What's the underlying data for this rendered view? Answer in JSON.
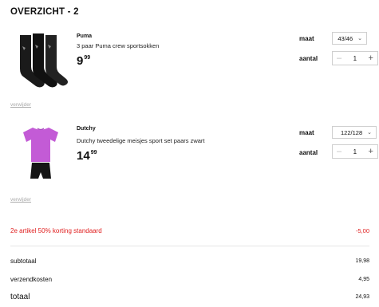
{
  "page": {
    "title": "OVERZICHT - 2"
  },
  "items": [
    {
      "brand": "Puma",
      "name": "3 paar Puma crew sportsokken",
      "price_main": "9",
      "price_cents": "99",
      "size_label": "maat",
      "size_value": "43/46",
      "qty_label": "aantal",
      "qty_value": "1",
      "remove_label": "verwijder",
      "image_icon": "socks-image"
    },
    {
      "brand": "Dutchy",
      "name": "Dutchy tweedelige meisjes sport set paars zwart",
      "price_main": "14",
      "price_cents": "99",
      "size_label": "maat",
      "size_value": "122/128",
      "qty_label": "aantal",
      "qty_value": "1",
      "remove_label": "verwijder",
      "image_icon": "sport-set-image"
    }
  ],
  "summary": {
    "discount_label": "2e artikel 50% korting standaard",
    "discount_value": "-5,00",
    "subtotal_label": "subtotaal",
    "subtotal_value": "19,98",
    "shipping_label": "verzendkosten",
    "shipping_value": "4,95",
    "total_label": "totaal",
    "total_value": "24,93"
  },
  "colors": {
    "discount": "#e02020",
    "border": "#cfcfcf",
    "muted": "#aaaaaa"
  }
}
